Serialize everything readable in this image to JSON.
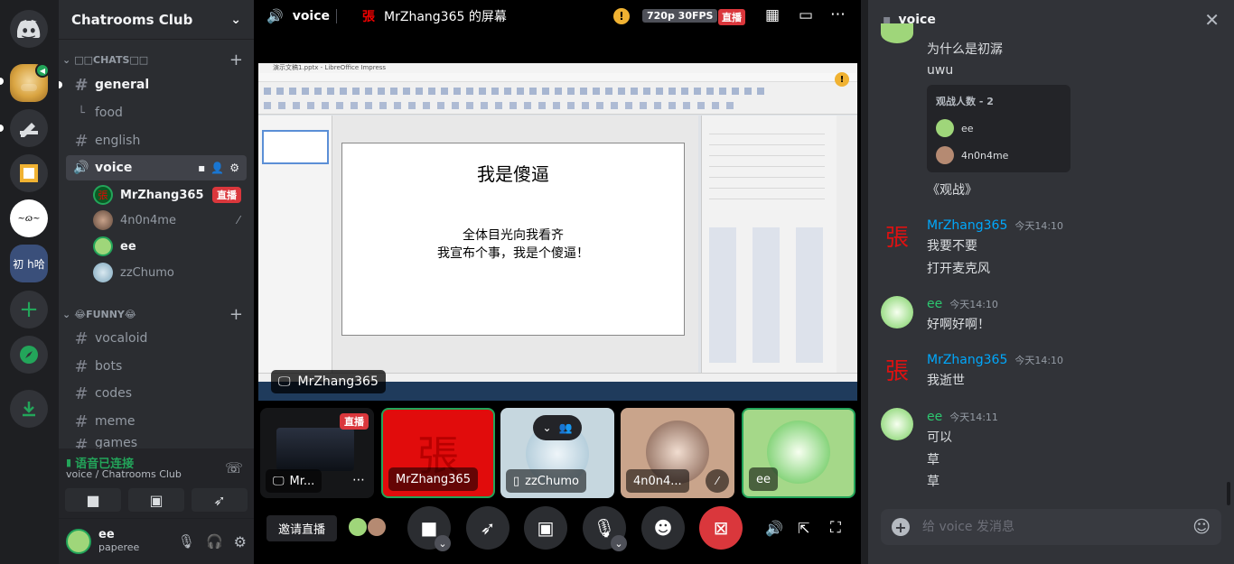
{
  "server": {
    "name": "Chatrooms Club",
    "server_icons": [
      "discord-home",
      "doge-server",
      "pencil-server",
      "box-server",
      "ink-server",
      "group-server"
    ],
    "group_server_label": "初 h哈"
  },
  "categories": [
    {
      "label": "□□CHATS□□"
    },
    {
      "label": "😂FUNNY😂"
    }
  ],
  "channels_chats": [
    {
      "name": "general",
      "active": true
    },
    {
      "name": "food",
      "thread": true
    },
    {
      "name": "english"
    },
    {
      "name": "voice",
      "voice": true
    }
  ],
  "voice_users": [
    {
      "name": "MrZhang365",
      "live": "直播"
    },
    {
      "name": "4n0n4me"
    },
    {
      "name": "ee"
    },
    {
      "name": "zzChumo"
    }
  ],
  "channels_funny": [
    "vocaloid",
    "bots",
    "codes",
    "meme",
    "games"
  ],
  "voice_status": {
    "title": "语音已连接",
    "subtitle": "voice / Chatrooms Club"
  },
  "user_panel": {
    "name": "ee",
    "status": "paperee"
  },
  "stage": {
    "channel": "voice",
    "stream_title": "MrZhang365 的屏幕",
    "quality": "720p 30FPS",
    "live": "直播",
    "screen_owner": "MrZhang365",
    "slide_title": "我是傻逼",
    "slide_body1": "全体目光向我看齐",
    "slide_body2": "我宣布个事，我是个傻逼！",
    "app_title": "演示文稿1.pptx - LibreOffice Impress",
    "invite": "邀请直播"
  },
  "tiles": [
    {
      "name": "Mr...",
      "live": "直播"
    },
    {
      "name": "MrZhang365"
    },
    {
      "name": "zzChumo"
    },
    {
      "name": "4n0n4..."
    },
    {
      "name": "ee"
    }
  ],
  "chat": {
    "channel": "voice",
    "placeholder": "给 voice 发消息",
    "viewer_card": {
      "title": "观战人数 - 2",
      "users": [
        "ee",
        "4n0n4me"
      ]
    },
    "messages": [
      {
        "line": "为什么是初潺"
      },
      {
        "line": "uwu"
      },
      {
        "line": "《观战》"
      },
      {
        "author": "MrZhang365",
        "time": "今天14:10",
        "lines": [
          "我要不要",
          "打开麦克风"
        ]
      },
      {
        "author": "ee",
        "time": "今天14:10",
        "lines": [
          "好啊好啊！"
        ]
      },
      {
        "author": "MrZhang365",
        "time": "今天14:10",
        "lines": [
          "我逝世"
        ]
      },
      {
        "author": "ee",
        "time": "今天14:11",
        "lines": [
          "可以",
          "草",
          "草"
        ]
      }
    ]
  },
  "colors": {
    "accent": "#5865f2",
    "live": "#da373c",
    "connected": "#23a55a",
    "link_author": "#00a8fc",
    "ee_author": "#2dc770"
  }
}
